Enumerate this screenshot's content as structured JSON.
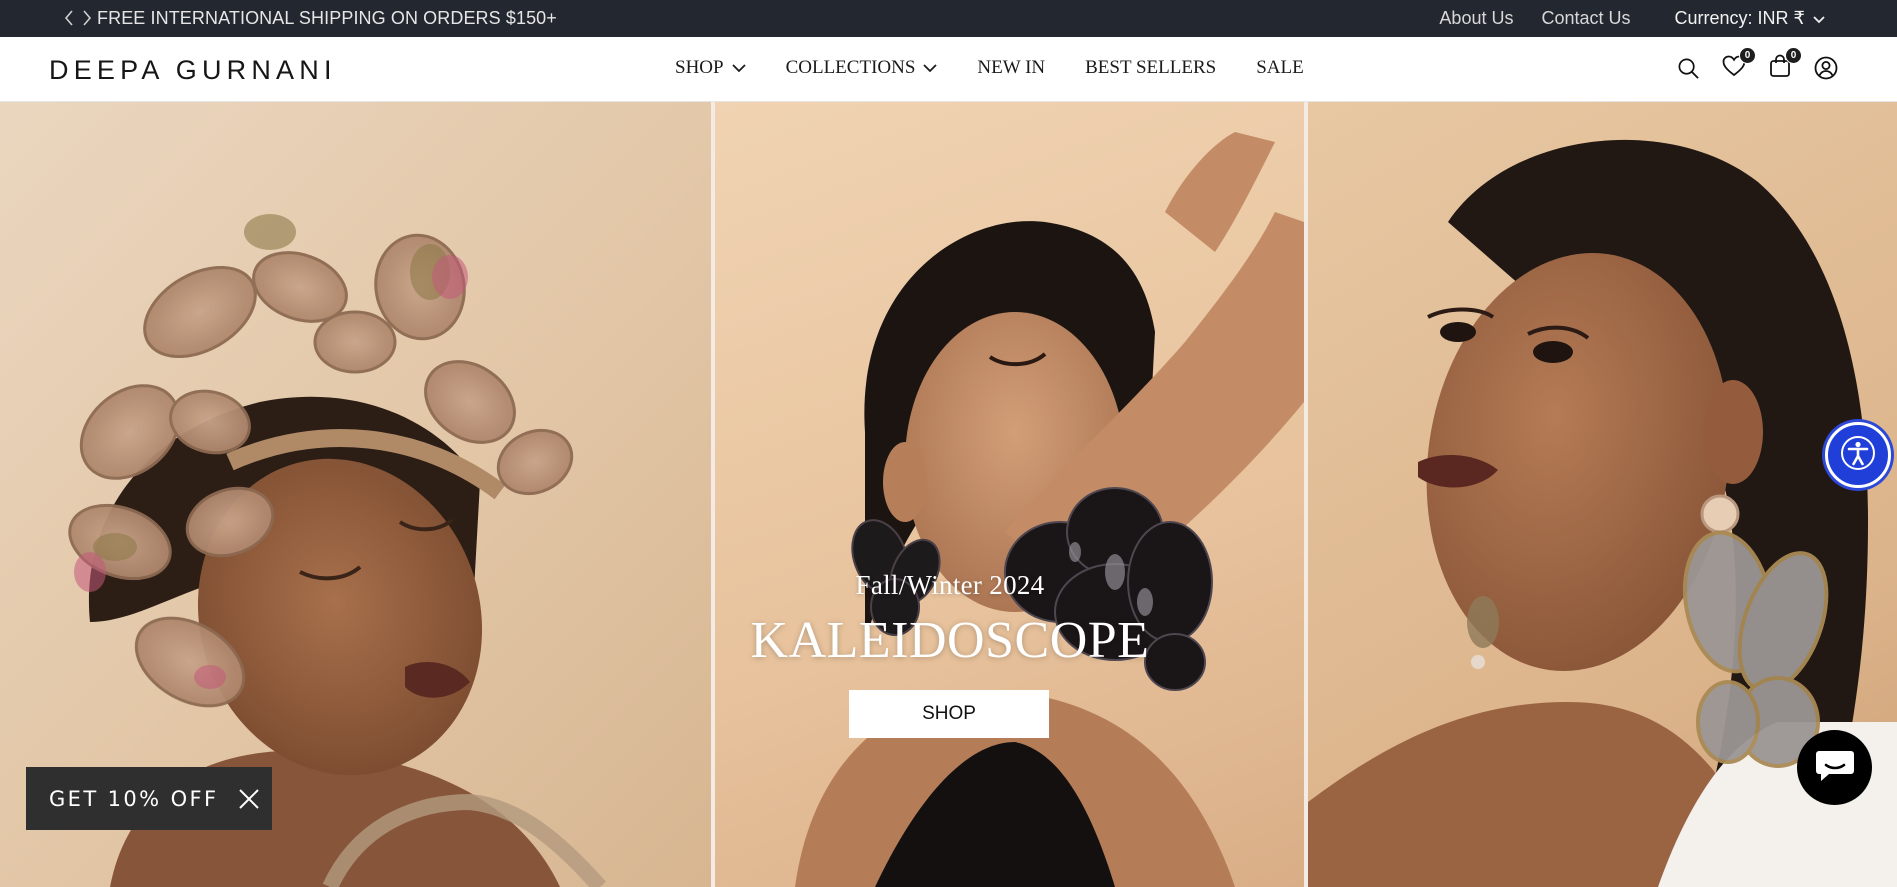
{
  "announcement": {
    "text": "FREE INTERNATIONAL SHIPPING ON ORDERS $150+",
    "prev_icon": "chevron-left-icon",
    "next_icon": "chevron-right-icon"
  },
  "utility_links": {
    "about": "About Us",
    "contact": "Contact Us",
    "currency_label": "Currency: INR ₹"
  },
  "header": {
    "logo": "DEEPA GURNANI",
    "nav": [
      {
        "label": "SHOP",
        "has_dropdown": true
      },
      {
        "label": "COLLECTIONS",
        "has_dropdown": true
      },
      {
        "label": "NEW IN",
        "has_dropdown": false
      },
      {
        "label": "BEST SELLERS",
        "has_dropdown": false
      },
      {
        "label": "SALE",
        "has_dropdown": false
      }
    ],
    "icons": {
      "search": "search-icon",
      "wishlist": "heart-icon",
      "cart": "shopping-bag-icon",
      "account": "account-icon"
    },
    "wishlist_count": "0",
    "cart_count": "0"
  },
  "hero": {
    "subtitle": "Fall/Winter 2024",
    "title": "KALEIDOSCOPE",
    "button": "SHOP"
  },
  "discount_tab": {
    "label": "GET 10% OFF",
    "close_icon": "close-icon"
  },
  "widgets": {
    "accessibility_icon": "accessibility-icon",
    "chat_icon": "chat-icon"
  },
  "colors": {
    "topbar_bg": "#232730",
    "discount_bg": "#2f2f30",
    "accessibility_bg": "#1f3fd8",
    "chat_bg": "#000000"
  }
}
